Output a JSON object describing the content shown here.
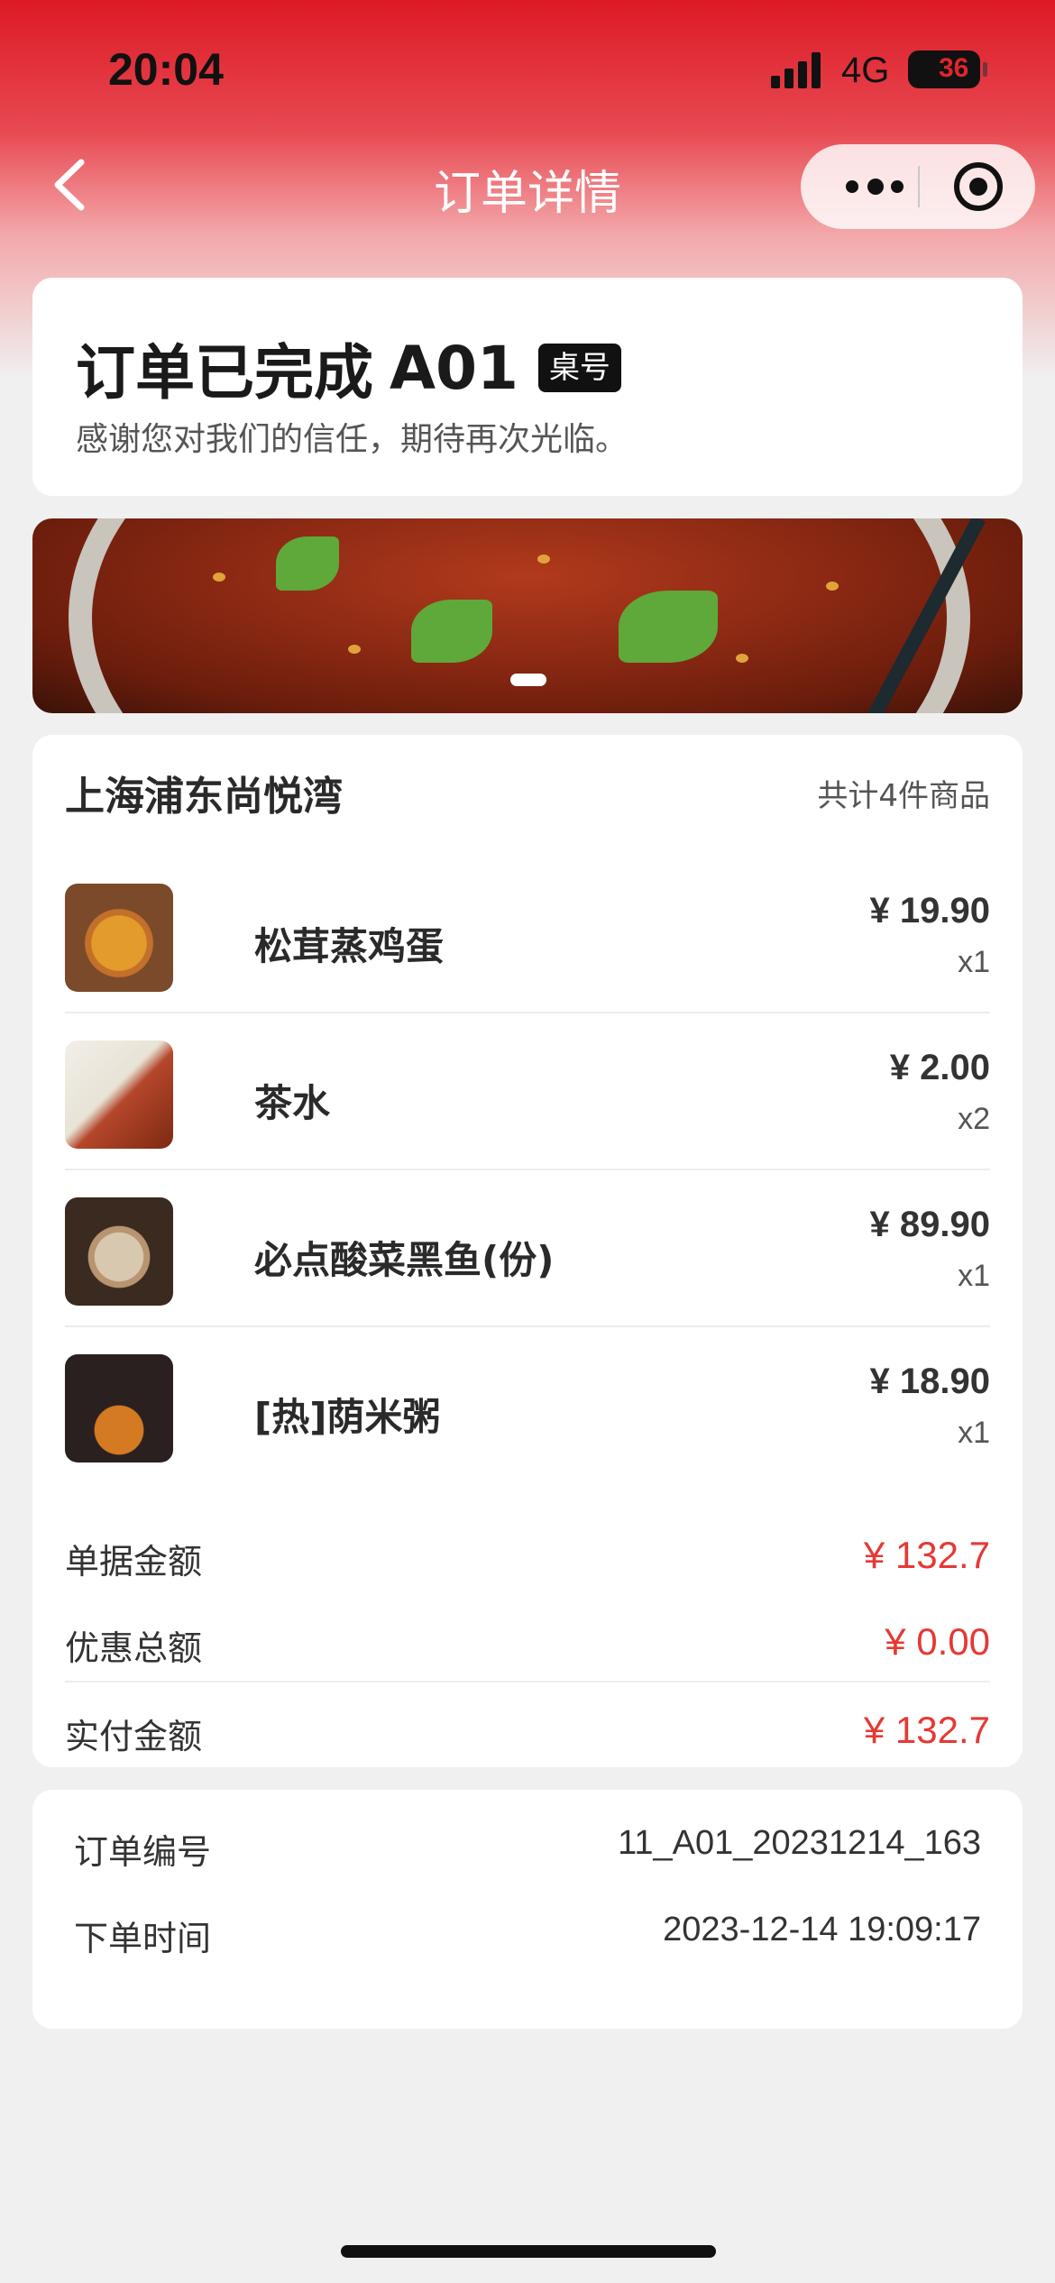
{
  "status_bar": {
    "time": "20:04",
    "network": "4G",
    "battery": "36"
  },
  "nav": {
    "title": "订单详情"
  },
  "order_status": {
    "title": "订单已完成",
    "table_no": "A01",
    "table_badge": "桌号",
    "subtitle": "感谢您对我们的信任，期待再次光临。"
  },
  "store": {
    "name": "上海浦东尚悦湾",
    "item_count": "共计4件商品"
  },
  "items": [
    {
      "name": "松茸蒸鸡蛋",
      "price": "¥ 19.90",
      "qty": "x1"
    },
    {
      "name": "茶水",
      "price": "¥ 2.00",
      "qty": "x2"
    },
    {
      "name": "必点酸菜黑鱼(份)",
      "price": "¥ 89.90",
      "qty": "x1"
    },
    {
      "name": "[热]荫米粥",
      "price": "¥ 18.90",
      "qty": "x1"
    }
  ],
  "summary": {
    "bill_label": "单据金额",
    "bill_value": "¥ 132.7",
    "discount_label": "优惠总额",
    "discount_value": "¥ 0.00",
    "paid_label": "实付金额",
    "paid_value": "¥ 132.7"
  },
  "info": {
    "order_no_label": "订单编号",
    "order_no": "11_A01_20231214_163",
    "order_time_label": "下单时间",
    "order_time": "2023-12-14 19:09:17"
  },
  "colors": {
    "brand_red": "#dc1a26",
    "price_red": "#e53935"
  }
}
